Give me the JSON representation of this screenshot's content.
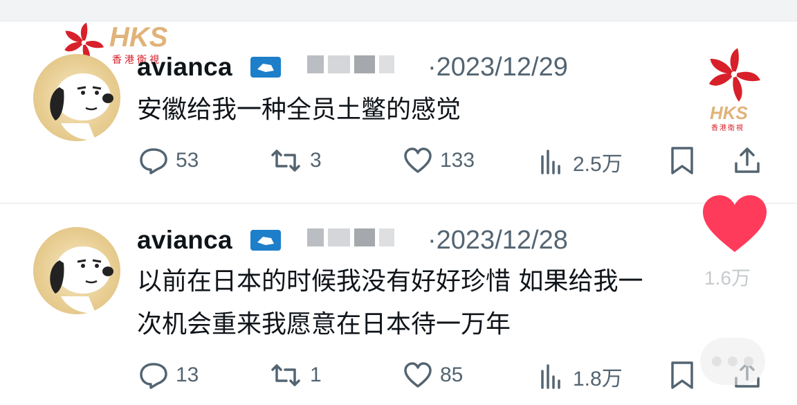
{
  "watermark": {
    "logo_text": "HKS",
    "logo_sub": "香港衛視"
  },
  "tweets": [
    {
      "username": "avianca",
      "date": "·2023/12/29",
      "text_lines": [
        "安徽给我一种全员土鳖的感觉"
      ],
      "replies": "53",
      "reposts": "3",
      "likes": "133",
      "views": "2.5万"
    },
    {
      "username": "avianca",
      "date": "·2023/12/28",
      "text_lines": [
        "以前在日本的时候我没有好好珍惜 如果给我一",
        "次机会重来我愿意在日本待一万年"
      ],
      "replies": "13",
      "reposts": "1",
      "likes": "85",
      "views": "1.8万"
    }
  ],
  "floating": {
    "like_count": "1.6万"
  },
  "colors": {
    "icon_gray": "#536471",
    "heart_red": "#ff3b5c",
    "badge_blue": "#1d7ec9",
    "logo_red": "#d8202a",
    "logo_gold": "#e0b37a"
  }
}
